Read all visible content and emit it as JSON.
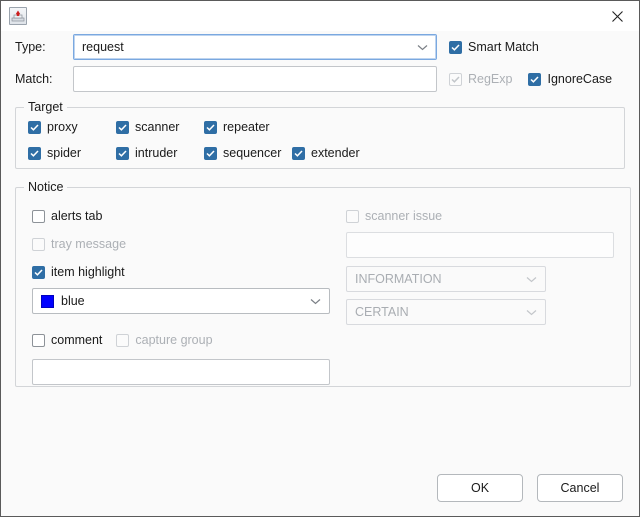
{
  "window": {
    "icon": "app-icon",
    "close_label": "×"
  },
  "form": {
    "type_label": "Type:",
    "type_value": "request",
    "match_label": "Match:",
    "match_value": "",
    "smart_match_label": "Smart Match",
    "smart_match_checked": true,
    "regexp_label": "RegExp",
    "regexp_checked": true,
    "regexp_disabled": true,
    "ignorecase_label": "IgnoreCase",
    "ignorecase_checked": true
  },
  "target": {
    "legend": "Target",
    "items": [
      {
        "label": "proxy",
        "checked": true
      },
      {
        "label": "scanner",
        "checked": true
      },
      {
        "label": "repeater",
        "checked": true
      },
      {
        "label": "spider",
        "checked": true
      },
      {
        "label": "intruder",
        "checked": true
      },
      {
        "label": "sequencer",
        "checked": true
      },
      {
        "label": "extender",
        "checked": true
      }
    ]
  },
  "notice": {
    "legend": "Notice",
    "alerts_tab_label": "alerts tab",
    "alerts_tab_checked": false,
    "tray_message_label": "tray message",
    "tray_message_checked": false,
    "tray_message_disabled": true,
    "item_highlight_label": "item highlight",
    "item_highlight_checked": true,
    "highlight_color_value": "blue",
    "highlight_color_hex": "#0000FF",
    "comment_label": "comment",
    "comment_checked": false,
    "capture_group_label": "capture group",
    "capture_group_checked": false,
    "capture_group_disabled": true,
    "comment_value": "",
    "scanner_issue_label": "scanner issue",
    "scanner_issue_checked": false,
    "scanner_issue_disabled": true,
    "issue_name_value": "",
    "severity_value": "INFORMATION",
    "confidence_value": "CERTAIN"
  },
  "footer": {
    "ok_label": "OK",
    "cancel_label": "Cancel"
  },
  "colors": {
    "checkbox_accent": "#2f6ea5",
    "focus_border": "#7aa8e0",
    "highlight_blue": "#0000FF"
  }
}
